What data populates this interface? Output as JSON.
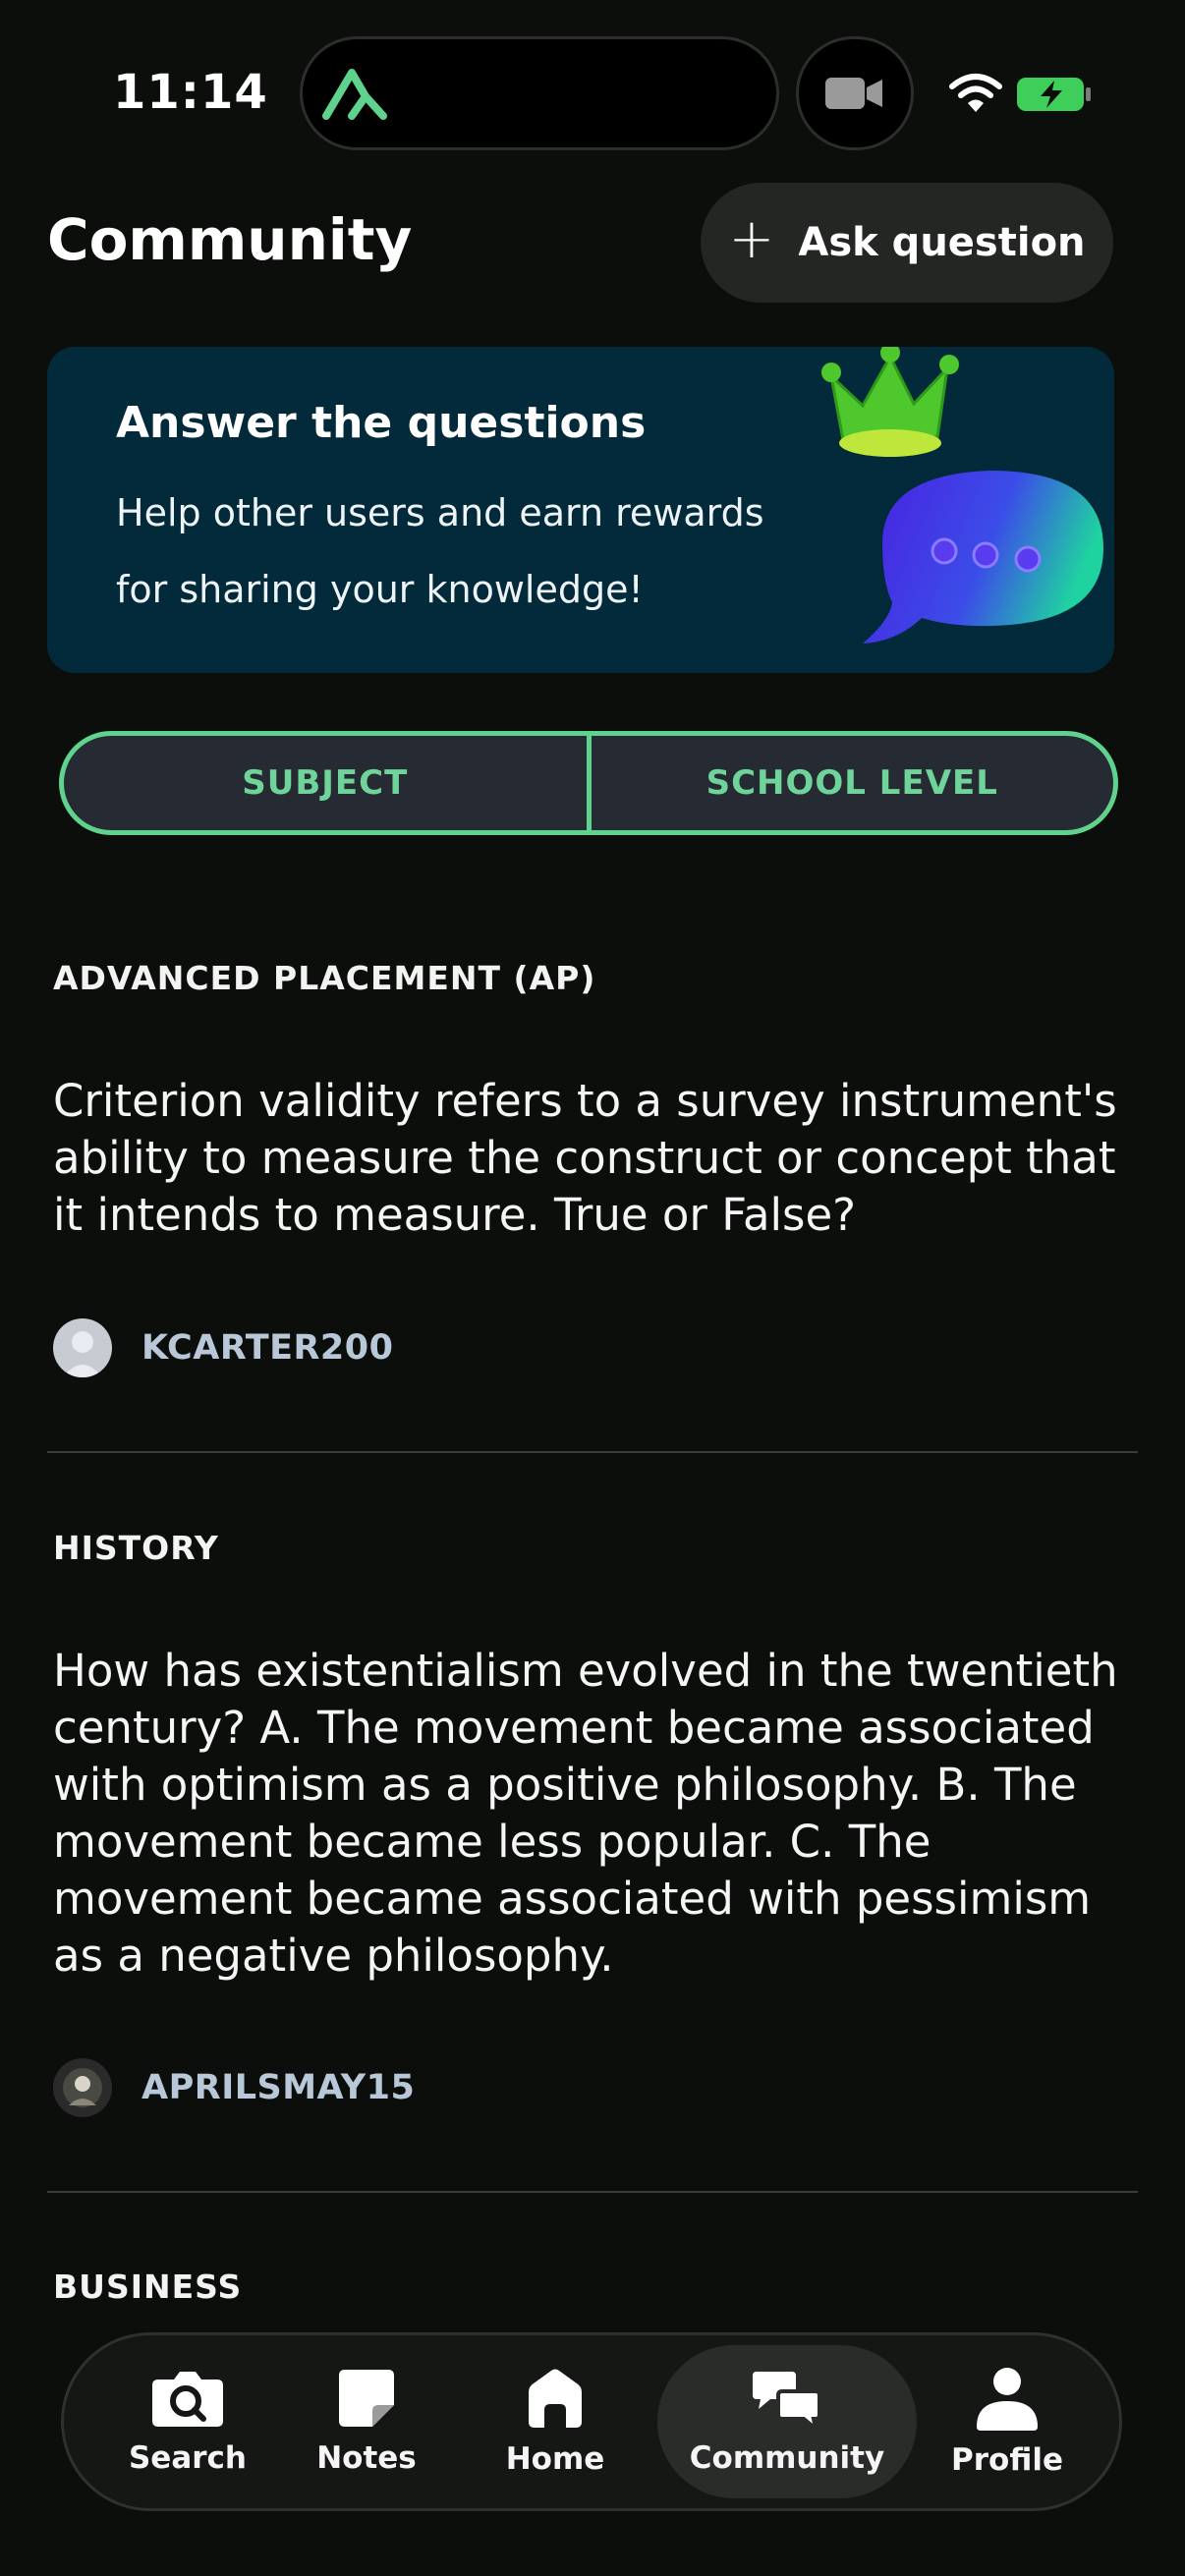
{
  "status_bar": {
    "time": "11:14"
  },
  "header": {
    "title": "Community",
    "ask_button": "Ask question"
  },
  "banner": {
    "title": "Answer the questions",
    "text": "Help other users and earn rewards for sharing your knowledge!"
  },
  "filters": [
    "SUBJECT",
    "SCHOOL LEVEL"
  ],
  "feed": [
    {
      "subject": "ADVANCED PLACEMENT (AP)",
      "question": "Criterion validity refers to a survey instrument's ability to measure the construct or concept that it intends to measure. True or False?",
      "author": "KCARTER200"
    },
    {
      "subject": "HISTORY",
      "question": "How has existentialism evolved in the twentieth century? A. The movement became associated with optimism as a positive philosophy. B. The movement became less popular. C. The movement became associated with pessimism as a negative philosophy.",
      "author": "APRILSMAY15"
    },
    {
      "subject": "BUSINESS"
    }
  ],
  "nav": [
    {
      "label": "Search",
      "icon": "camera-search-icon"
    },
    {
      "label": "Notes",
      "icon": "notes-icon"
    },
    {
      "label": "Home",
      "icon": "home-icon"
    },
    {
      "label": "Community",
      "icon": "chat-bubbles-icon",
      "active": true
    },
    {
      "label": "Profile",
      "icon": "person-icon"
    }
  ],
  "colors": {
    "accent": "#5fd38d",
    "background": "#0b0e0b",
    "banner": "#022a3a"
  }
}
